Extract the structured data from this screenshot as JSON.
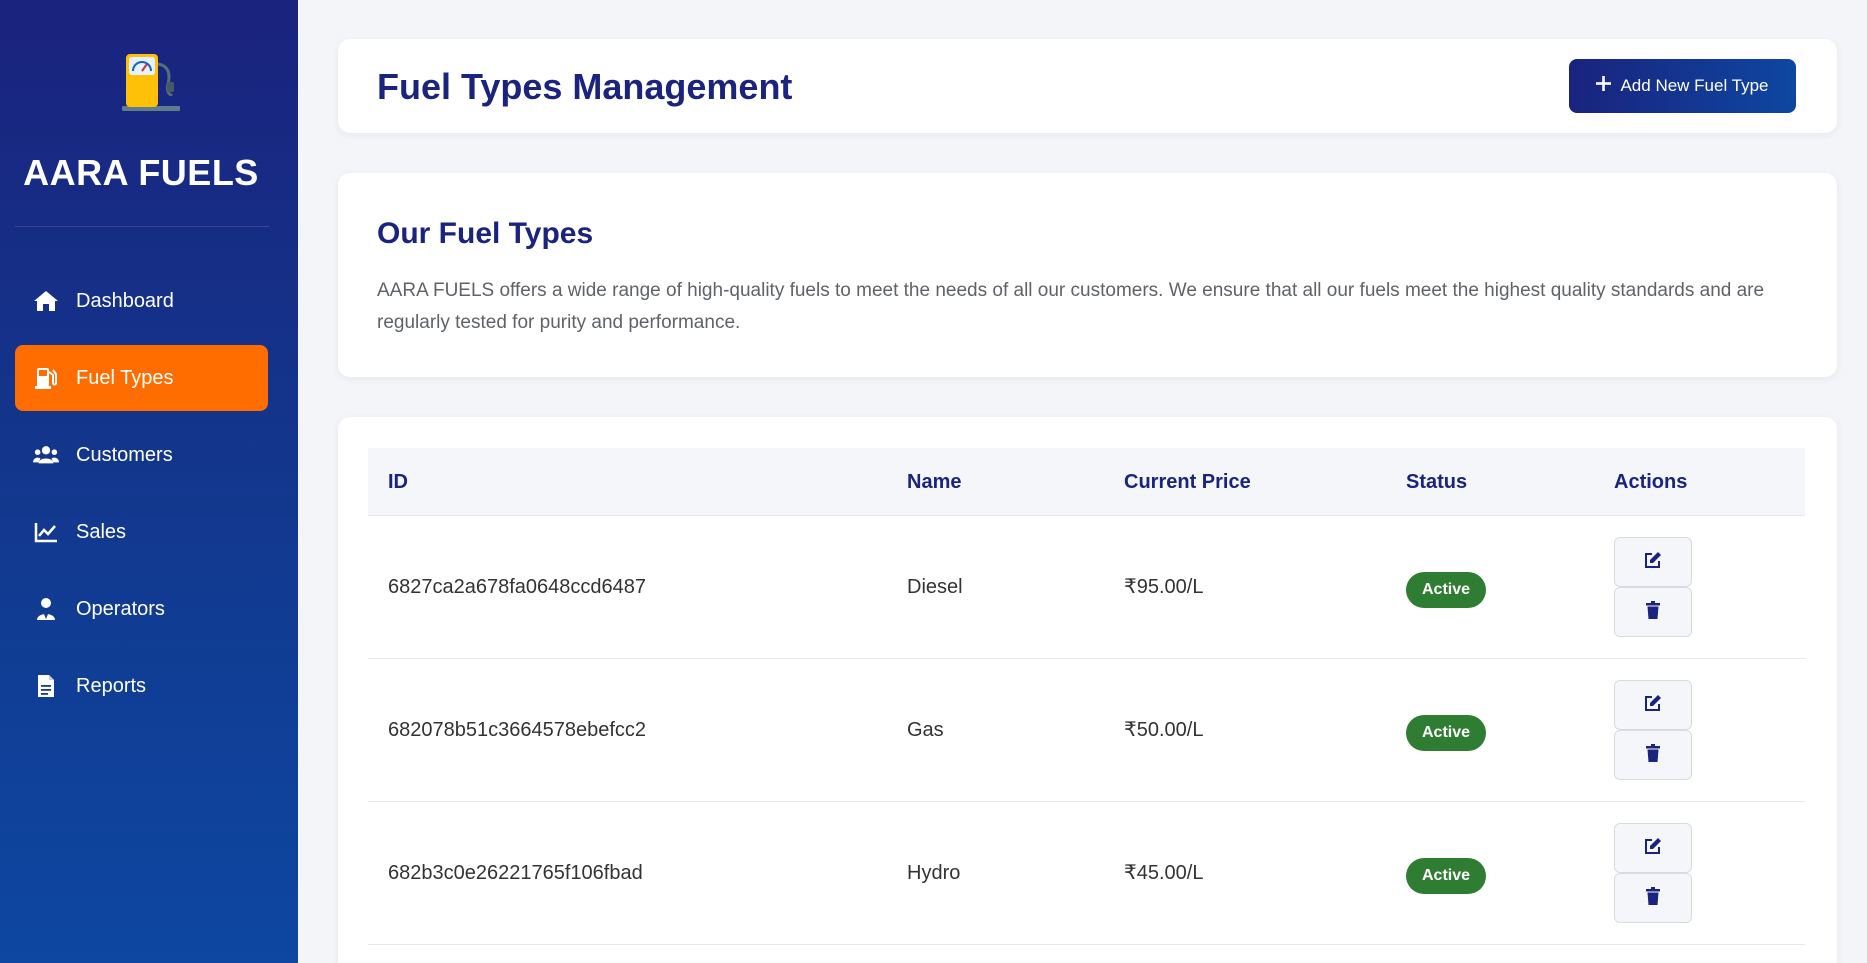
{
  "sidebar": {
    "logo_icon": "fuel-pump-logo",
    "brand": "AARA FUELS",
    "items": [
      {
        "label": "Dashboard",
        "icon": "home-icon",
        "active": false
      },
      {
        "label": "Fuel Types",
        "icon": "fuel-pump-icon",
        "active": true
      },
      {
        "label": "Customers",
        "icon": "users-icon",
        "active": false
      },
      {
        "label": "Sales",
        "icon": "line-chart-icon",
        "active": false
      },
      {
        "label": "Operators",
        "icon": "user-tie-icon",
        "active": false
      },
      {
        "label": "Reports",
        "icon": "document-icon",
        "active": false
      }
    ]
  },
  "header": {
    "title": "Fuel Types Management",
    "add_button_label": "Add New Fuel Type"
  },
  "intro": {
    "title": "Our Fuel Types",
    "description": "AARA FUELS offers a wide range of high-quality fuels to meet the needs of all our customers. We ensure that all our fuels meet the highest quality standards and are regularly tested for purity and performance."
  },
  "table": {
    "columns": [
      "ID",
      "Name",
      "Current Price",
      "Status",
      "Actions"
    ],
    "rows": [
      {
        "id": "6827ca2a678fa0648ccd6487",
        "name": "Diesel",
        "price": "₹95.00/L",
        "status": "Active"
      },
      {
        "id": "682078b51c3664578ebefcc2",
        "name": "Gas",
        "price": "₹50.00/L",
        "status": "Active"
      },
      {
        "id": "682b3c0e26221765f106fbad",
        "name": "Hydro",
        "price": "₹45.00/L",
        "status": "Active"
      }
    ]
  },
  "colors": {
    "primary": "#1a237e",
    "accent": "#ff6d00",
    "active_badge": "#2e7d32"
  }
}
